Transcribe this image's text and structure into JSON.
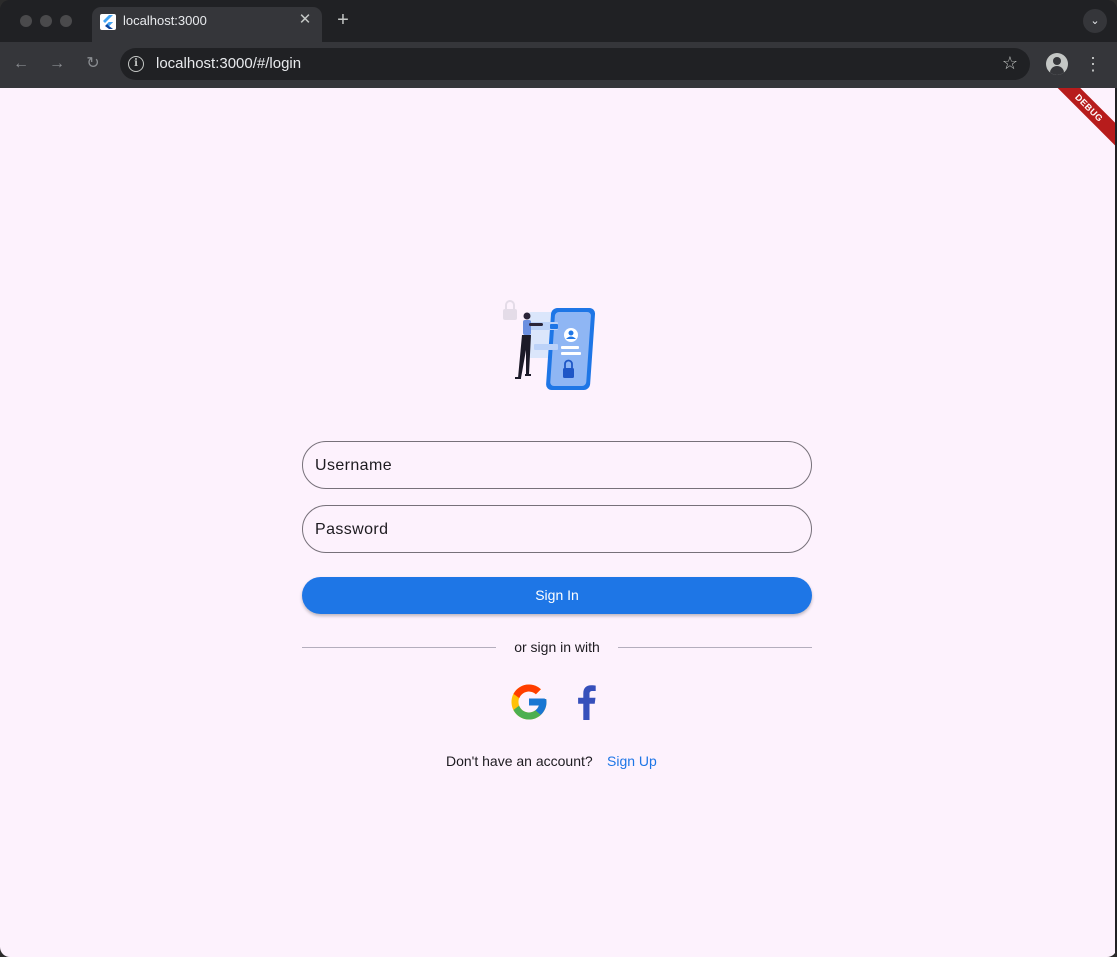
{
  "browser": {
    "tab": {
      "title": "localhost:3000",
      "close": "✕"
    },
    "new_tab": "+",
    "tab_search": "⌄",
    "nav": {
      "back": "←",
      "forward": "→",
      "reload": "↻"
    },
    "info": "i",
    "url": "localhost:3000/#/login",
    "bookmark": "☆",
    "menu": "⋮"
  },
  "debug_banner": "DEBUG",
  "login": {
    "username_label": "Username",
    "password_label": "Password",
    "sign_in": "Sign In",
    "divider": "or sign in with",
    "no_account": "Don't have an account?",
    "sign_up": "Sign Up"
  },
  "social": {
    "google_icon": "google-icon",
    "facebook_icon": "facebook-icon"
  },
  "colors": {
    "accent": "#1e76e6",
    "page_bg": "#fdf2fd",
    "debug": "#b71c1c"
  }
}
